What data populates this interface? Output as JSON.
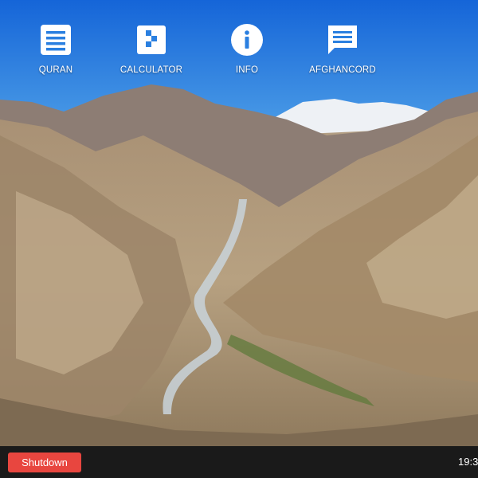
{
  "desktop": {
    "icons": [
      {
        "label": "QURAN",
        "icon": "book-list-icon"
      },
      {
        "label": "CALCULATOR",
        "icon": "calculator-icon"
      },
      {
        "label": "INFO",
        "icon": "info-icon"
      },
      {
        "label": "AFGHANCORD",
        "icon": "chat-bubble-icon"
      }
    ],
    "wallpaper": "mountain-valley-landscape"
  },
  "taskbar": {
    "shutdown_label": "Shutdown",
    "clock": "19:3"
  },
  "colors": {
    "shutdown_button": "#e8463f",
    "taskbar": "#1a1a1a",
    "sky": "#2a7fe0"
  }
}
